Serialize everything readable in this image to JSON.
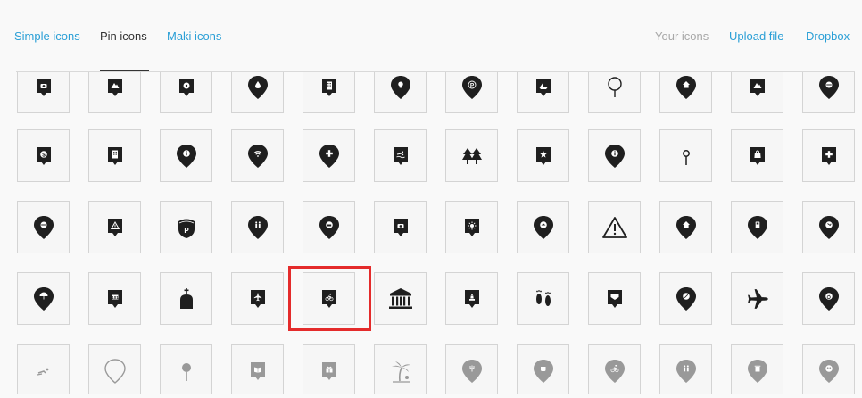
{
  "tabs": {
    "simple": "Simple icons",
    "pin": "Pin icons",
    "maki": "Maki icons",
    "your": "Your icons",
    "upload": "Upload file",
    "dropbox": "Dropbox"
  },
  "colors": {
    "link": "#2a9fd6",
    "active_tab": "#333333",
    "disabled_tab": "#a8a8a8",
    "icon": "#1f1f1f",
    "icon_faded": "#999999",
    "selection": "#e42b2b"
  },
  "icon_rows": [
    [
      "camera-pin-icon",
      "mountain-pin-icon",
      "soccer-pin-icon",
      "water-drop-pin-icon",
      "info-booth-pin-icon",
      "lightbulb-pin-icon",
      "parking-pin-icon",
      "sailboat-pin-icon",
      "empty-circle-pin-icon",
      "campfire-pin-icon",
      "ship-pin-icon",
      "phone-pin-icon"
    ],
    [
      "money-pin-icon",
      "building-pin-icon",
      "info-pin-icon",
      "wifi-pin-icon",
      "first-aid-pin-icon",
      "swimming-pin-icon",
      "trees-icon",
      "star-pin-icon",
      "info-pin-icon",
      "small-circle-pin-icon",
      "shopping-bag-pin-icon",
      "hospital-pin-icon"
    ],
    [
      "circle-line-pin-icon",
      "warning-pin-icon",
      "parking-shield-icon",
      "restroom-pin-icon",
      "toilet-pin-icon",
      "camera-square-pin-icon",
      "sun-pin-icon",
      "shower-pin-icon",
      "warning-triangle-icon",
      "home-pin-icon",
      "fuel-pin-icon",
      "run-pin-icon"
    ],
    [
      "umbrella-pin-icon",
      "cinema-pin-icon",
      "church-icon",
      "airport-pin-icon",
      "bicycle-pin-icon",
      "museum-icon",
      "statue-pin-icon",
      "footprints-icon",
      "bed-pin-icon",
      "leaf-pin-icon",
      "airplane-icon",
      "wheelchair-pin-icon"
    ],
    [
      "swimmer-icon",
      "empty-pin-icon",
      "pin-icon",
      "book-pin-icon",
      "gift-pin-icon",
      "beach-icon",
      "fork-pin-icon",
      "coffee-pin-icon",
      "bike-pin-icon",
      "toilets-pin-icon",
      "trash-pin-icon",
      "people-pin-icon"
    ]
  ],
  "selected_icon": "bicycle-pin-icon"
}
